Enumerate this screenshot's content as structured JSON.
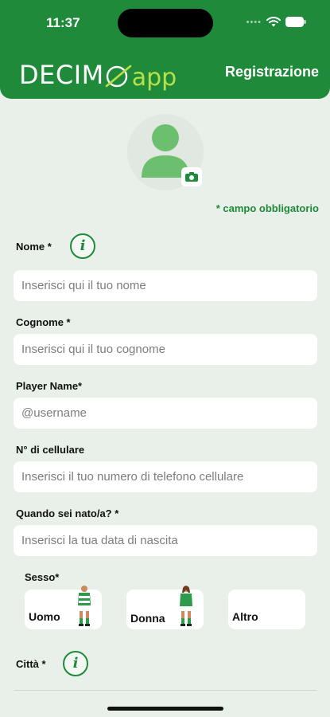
{
  "status_bar": {
    "time": "11:37"
  },
  "header": {
    "logo_part1": "DECIM",
    "logo_part2": "app",
    "title": "Registrazione",
    "colors": {
      "brand": "#1e8a3a",
      "logo_accent": "#b7e04a"
    }
  },
  "required_note": "* campo obbligatorio",
  "fields": {
    "nome": {
      "label": "Nome *",
      "placeholder": "Inserisci qui il tuo nome"
    },
    "cognome": {
      "label": "Cognome *",
      "placeholder": "Inserisci qui il tuo cognome"
    },
    "player_name": {
      "label": "Player Name*",
      "placeholder": "@username"
    },
    "cellulare": {
      "label": "N° di cellulare",
      "placeholder": "Inserisci il tuo numero di telefono cellulare"
    },
    "nascita": {
      "label": "Quando sei nato/a? *",
      "placeholder": "Inserisci la tua data di nascita"
    },
    "citta": {
      "label": "Città *"
    }
  },
  "gender": {
    "label": "Sesso*",
    "options": [
      "Uomo",
      "Donna",
      "Altro"
    ]
  },
  "icons": {
    "info": "i"
  }
}
